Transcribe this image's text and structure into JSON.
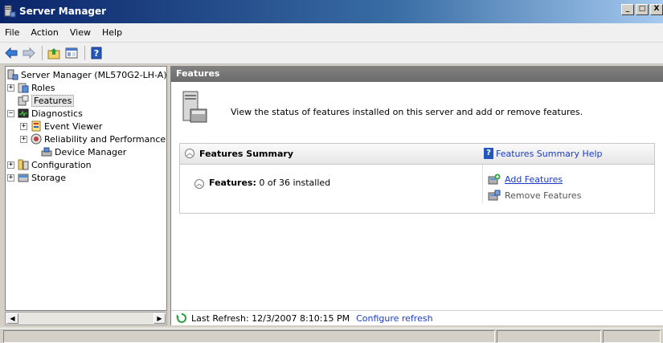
{
  "window": {
    "title": "Server Manager",
    "icon": "server-manager-icon",
    "controls": [
      "_",
      "□",
      "X"
    ]
  },
  "menu": [
    "File",
    "Action",
    "View",
    "Help"
  ],
  "toolbar": {
    "buttons": [
      "back-arrow-icon",
      "forward-arrow-icon",
      "up-folder-icon",
      "show-hide-tree-icon",
      "help-icon"
    ]
  },
  "tree": {
    "root": "Server Manager (ML570G2-LH-A)",
    "roles": "Roles",
    "features": "Features",
    "diagnostics": "Diagnostics",
    "event_viewer": "Event Viewer",
    "reliability": "Reliability and Performance",
    "device_manager": "Device Manager",
    "configuration": "Configuration",
    "storage": "Storage"
  },
  "content": {
    "header": "Features",
    "intro": "View the status of features installed on this server and add or remove features.",
    "summary_title": "Features Summary",
    "help_link": "Features Summary Help",
    "features_label": "Features:",
    "features_count": "0 of 36 installed",
    "add_features": "Add Features",
    "remove_features": "Remove Features",
    "last_refresh": "Last Refresh: 12/3/2007 8:10:15 PM",
    "configure_refresh": "Configure refresh"
  },
  "colors": {
    "link": "#1a3cc4",
    "header_bg": "#6b6b6b",
    "titlebar": "#0a246a"
  }
}
